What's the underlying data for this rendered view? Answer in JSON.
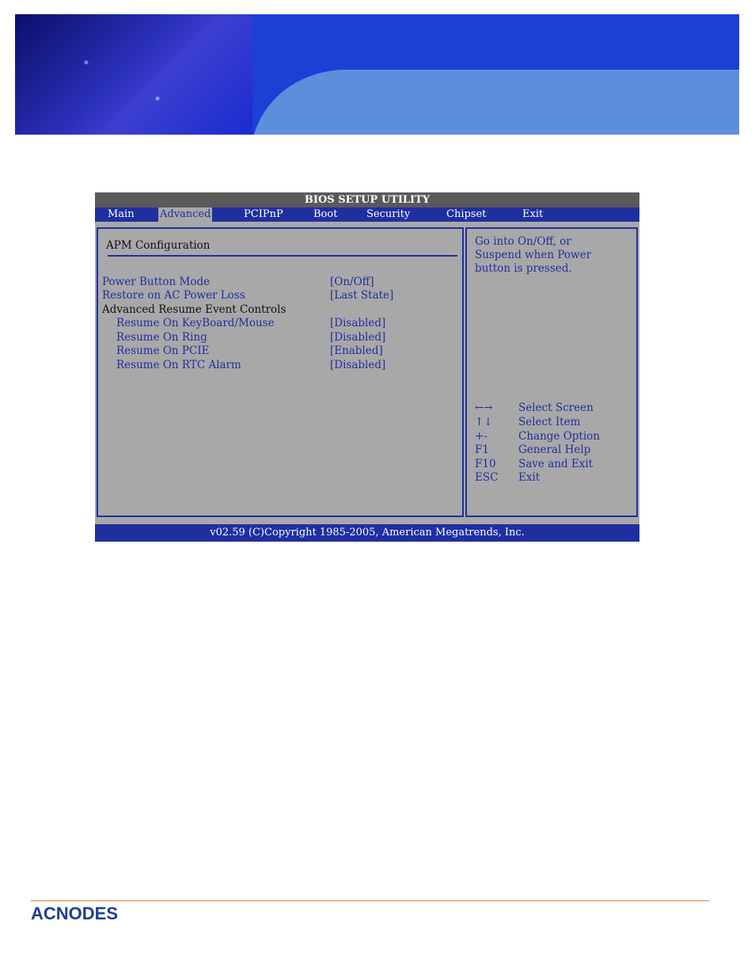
{
  "bios": {
    "title": "BIOS SETUP UTILITY",
    "menu": [
      "Main",
      "Advanced",
      "PCIPnP",
      "Boot",
      "Security",
      "Chipset",
      "Exit"
    ],
    "active_menu": "Advanced",
    "section_title": "APM Configuration",
    "settings": [
      {
        "label": "Power Button Mode",
        "value": "[On/Off]"
      },
      {
        "label": "Restore on AC Power Loss",
        "value": "[Last State]"
      }
    ],
    "group_heading": "Advanced Resume Event Controls",
    "sub_settings": [
      {
        "label": "Resume On KeyBoard/Mouse",
        "value": "[Disabled]"
      },
      {
        "label": "Resume On Ring",
        "value": "[Disabled]"
      },
      {
        "label": "Resume On PCIE",
        "value": "[Enabled]"
      },
      {
        "label": "Resume On RTC Alarm",
        "value": "[Disabled]"
      }
    ],
    "help_text": [
      "Go into On/Off, or",
      "Suspend when Power",
      "button is pressed."
    ],
    "keys": [
      {
        "key": "←→",
        "desc": "Select Screen"
      },
      {
        "key": "↑↓",
        "desc": "Select Item"
      },
      {
        "key": "+-",
        "desc": "Change Option"
      },
      {
        "key": "F1",
        "desc": "General Help"
      },
      {
        "key": "F10",
        "desc": "Save and Exit"
      },
      {
        "key": "ESC",
        "desc": "Exit"
      }
    ],
    "footer": "v02.59 (C)Copyright 1985-2005, American Megatrends, Inc."
  },
  "brand": {
    "logo_text": "ACNODES"
  },
  "colors": {
    "bios_blue": "#1f2fa0",
    "bios_gray": "#a8a8a8",
    "accent_rule": "#e07b3a"
  }
}
